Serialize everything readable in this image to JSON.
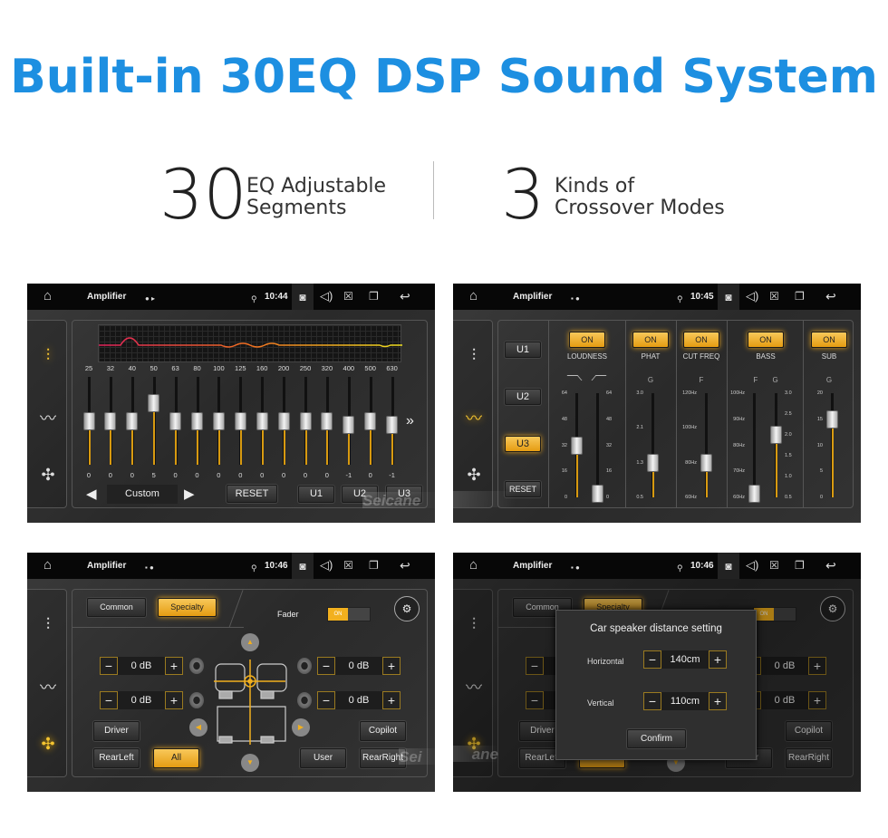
{
  "header": {
    "title": "Built-in 30EQ DSP Sound System",
    "stat1": {
      "number": "30",
      "line1": "EQ Adjustable",
      "line2": "Segments"
    },
    "stat2": {
      "number": "3",
      "line1": "Kinds of",
      "line2": "Crossover Modes"
    }
  },
  "colors": {
    "title_blue": "#1d8fe1",
    "accent": "#f2b01e"
  },
  "watermark": "Seicane",
  "panels": [
    {
      "app_title": "Amplifier",
      "time": "10:44",
      "active_tab": 0
    },
    {
      "app_title": "Amplifier",
      "time": "10:45",
      "active_tab": 1
    },
    {
      "app_title": "Amplifier",
      "time": "10:46",
      "active_tab": 2
    },
    {
      "app_title": "Amplifier",
      "time": "10:46",
      "active_tab": 2
    }
  ],
  "eq": {
    "range": [
      -12,
      12
    ],
    "bands": [
      {
        "freq": "25",
        "value": 0
      },
      {
        "freq": "32",
        "value": 0
      },
      {
        "freq": "40",
        "value": 0
      },
      {
        "freq": "50",
        "value": 5
      },
      {
        "freq": "63",
        "value": 0
      },
      {
        "freq": "80",
        "value": 0
      },
      {
        "freq": "100",
        "value": 0
      },
      {
        "freq": "125",
        "value": 0
      },
      {
        "freq": "160",
        "value": 0
      },
      {
        "freq": "200",
        "value": 0
      },
      {
        "freq": "250",
        "value": 0
      },
      {
        "freq": "320",
        "value": 0
      },
      {
        "freq": "400",
        "value": -1
      },
      {
        "freq": "500",
        "value": 0
      },
      {
        "freq": "630",
        "value": -1
      }
    ],
    "preset": "Custom",
    "reset": "RESET",
    "users": [
      "U1",
      "U2",
      "U3"
    ],
    "more_icon": "double-chevron-right"
  },
  "crossover": {
    "users": [
      "U1",
      "U2",
      "U3"
    ],
    "active_user": "U3",
    "reset": "RESET",
    "groups": [
      {
        "label": "LOUDNESS",
        "toggle": "ON"
      },
      {
        "label": "PHAT",
        "toggle": "ON",
        "sub": "G"
      },
      {
        "label": "CUT FREQ",
        "toggle": "ON",
        "sub": "F"
      },
      {
        "label": "BASS",
        "toggle": "ON",
        "sub": "F G"
      },
      {
        "label": "SUB",
        "toggle": "ON",
        "sub": "G"
      }
    ],
    "sliders": [
      {
        "name": "loudness-low",
        "ticks": [
          "64",
          "48",
          "32",
          "16",
          "0"
        ],
        "value": "32"
      },
      {
        "name": "loudness-high",
        "ticks": [
          "64",
          "48",
          "32",
          "16",
          "0"
        ],
        "value": "0"
      },
      {
        "name": "phat-gain",
        "ticks": [
          "3.0",
          "2.1",
          "1.3",
          "0.5"
        ],
        "value": "1.3"
      },
      {
        "name": "cut-freq",
        "ticks": [
          "120Hz",
          "100Hz",
          "80Hz",
          "60Hz"
        ],
        "value": "80Hz"
      },
      {
        "name": "bass-freq",
        "ticks": [
          "100Hz",
          "90Hz",
          "80Hz",
          "70Hz",
          "60Hz"
        ],
        "value": "60Hz"
      },
      {
        "name": "bass-gain",
        "ticks": [
          "3.0",
          "2.5",
          "2.0",
          "1.5",
          "1.0",
          "0.5"
        ],
        "value": "2.0"
      },
      {
        "name": "sub-gain",
        "ticks": [
          "20",
          "15",
          "10",
          "5",
          "0"
        ],
        "value": "15"
      }
    ]
  },
  "balance": {
    "tabs": [
      "Common",
      "Specialty"
    ],
    "active_tab": "Specialty",
    "fader_label": "Fader",
    "fader_state": "ON",
    "speakers": [
      "0 dB",
      "0 dB",
      "0 dB",
      "0 dB"
    ],
    "buttons": {
      "driver": "Driver",
      "rear_left": "RearLeft",
      "all": "All",
      "user": "User",
      "copilot": "Copilot",
      "rear_right": "RearRight"
    },
    "active_button": "All"
  },
  "dialog": {
    "title": "Car speaker distance setting",
    "horizontal_label": "Horizontal",
    "horizontal_value": "140cm",
    "vertical_label": "Vertical",
    "vertical_value": "110cm",
    "confirm": "Confirm"
  }
}
